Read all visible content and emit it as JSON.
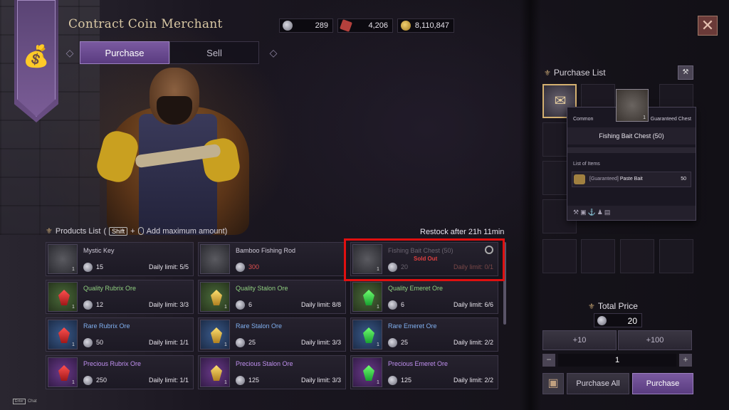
{
  "header": {
    "title": "Contract Coin Merchant",
    "tabs": [
      {
        "label": "Purchase",
        "active": true
      },
      {
        "label": "Sell",
        "active": false
      }
    ],
    "close_icon": "close-x-icon"
  },
  "currencies": [
    {
      "icon": "silver-coin-icon",
      "value": "289"
    },
    {
      "icon": "red-token-icon",
      "value": "4,206"
    },
    {
      "icon": "gold-coin-icon",
      "value": "8,110,847"
    }
  ],
  "products": {
    "title": "Products List",
    "shift_key": "Shift",
    "plus": "+",
    "hint": "Add maximum amount)",
    "paren_open": "(",
    "restock_label": "Restock after",
    "restock_time": "21h 11min",
    "items": [
      {
        "name": "Mystic Key",
        "qty": "1",
        "price": "15",
        "limit": "Daily limit: 5/5",
        "tier": "normal",
        "icon": "key-axe-icon"
      },
      {
        "name": "Bamboo Fishing Rod",
        "qty": "",
        "price": "300",
        "limit": "",
        "tier": "normal",
        "icon": "fishing-rod-icon",
        "price_unaffordable": true
      },
      {
        "name": "Fishing Bait Chest (50)",
        "qty": "1",
        "price": "20",
        "limit": "Daily limit: 0/1",
        "tier": "normal",
        "icon": "chest-icon",
        "sold_out": true,
        "sold_out_label": "Sold Out"
      },
      {
        "name": "Quality Rubrix Ore",
        "qty": "1",
        "price": "12",
        "limit": "Daily limit: 3/3",
        "tier": "green",
        "gem": "red"
      },
      {
        "name": "Quality Stalon Ore",
        "qty": "1",
        "price": "6",
        "limit": "Daily limit: 8/8",
        "tier": "green",
        "gem": "gold"
      },
      {
        "name": "Quality Emeret Ore",
        "qty": "1",
        "price": "6",
        "limit": "Daily limit: 6/6",
        "tier": "green",
        "gem": "green"
      },
      {
        "name": "Rare Rubrix Ore",
        "qty": "1",
        "price": "50",
        "limit": "Daily limit: 1/1",
        "tier": "blue",
        "gem": "red"
      },
      {
        "name": "Rare Stalon Ore",
        "qty": "1",
        "price": "25",
        "limit": "Daily limit: 3/3",
        "tier": "blue",
        "gem": "gold"
      },
      {
        "name": "Rare Emeret Ore",
        "qty": "1",
        "price": "25",
        "limit": "Daily limit: 2/2",
        "tier": "blue",
        "gem": "green"
      },
      {
        "name": "Precious Rubrix Ore",
        "qty": "1",
        "price": "250",
        "limit": "Daily limit: 1/1",
        "tier": "purple",
        "gem": "red"
      },
      {
        "name": "Precious Stalon Ore",
        "qty": "1",
        "price": "125",
        "limit": "Daily limit: 3/3",
        "tier": "purple",
        "gem": "gold"
      },
      {
        "name": "Precious Emeret Ore",
        "qty": "1",
        "price": "125",
        "limit": "Daily limit: 2/2",
        "tier": "purple",
        "gem": "green"
      }
    ]
  },
  "purchase_list": {
    "title": "Purchase List",
    "tooltip": {
      "thumb_qty": "1",
      "rarity": "Common",
      "tag": "Guaranteed Chest",
      "name": "Fishing Bait Chest (50)",
      "list_label": "List of Items",
      "row_prefix": "[Guaranteed]",
      "row_name": "Paste Bait",
      "row_qty": "50",
      "footer_icons": "⚒▣⚓♟▤"
    },
    "total_label": "Total Price",
    "total_value": "20",
    "plus10": "+10",
    "plus100": "+100",
    "quantity": "1",
    "minus": "−",
    "plus": "+",
    "purchase_all": "Purchase All",
    "purchase": "Purchase"
  },
  "footer": {
    "enter_key": "Enter",
    "chat_label": "Chat"
  },
  "colors": {
    "accent_purple": "#7a5aa0",
    "highlight_red": "#e01010",
    "sold_out_red": "#e04040"
  }
}
